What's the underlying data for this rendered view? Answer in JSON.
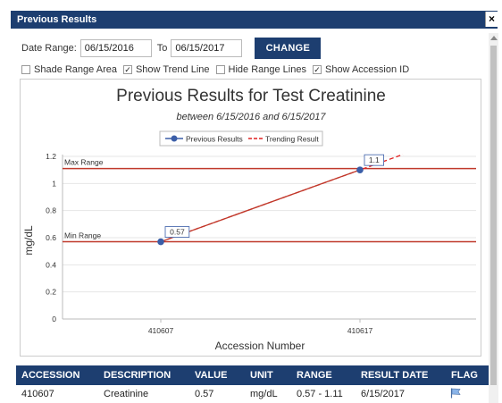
{
  "window": {
    "title": "Previous Results",
    "close": "×"
  },
  "toolbar": {
    "date_range_label": "Date Range:",
    "from_value": "06/15/2016",
    "to_label": "To",
    "to_value": "06/15/2017",
    "change_label": "CHANGE"
  },
  "options": [
    {
      "label": "Shade Range Area",
      "checked": false
    },
    {
      "label": "Show Trend Line",
      "checked": true
    },
    {
      "label": "Hide Range Lines",
      "checked": false
    },
    {
      "label": "Show Accession ID",
      "checked": true
    }
  ],
  "chart_data": {
    "type": "line",
    "title": "Previous Results for Test Creatinine",
    "subtitle": "between 6/15/2016 and 6/15/2017",
    "xlabel": "Accession Number",
    "ylabel": "mg/dL",
    "categories": [
      "410607",
      "410617"
    ],
    "ylim": [
      0,
      1.2
    ],
    "yticks": [
      "0",
      "0.2",
      "0.4",
      "0.6",
      "0.8",
      "1",
      "1.2"
    ],
    "legend": {
      "placement": "top-center",
      "items": [
        "Previous Results",
        "Trending Result"
      ]
    },
    "series": [
      {
        "name": "Previous Results",
        "values": [
          0.57,
          1.1
        ],
        "point_labels": [
          "0.57",
          "1.1"
        ],
        "color": "#1d3e70",
        "line_color": "#c0392b"
      },
      {
        "name": "Trending Result",
        "values": [
          0.57,
          1.1
        ],
        "extends_beyond": true,
        "color": "#e02020",
        "dashed": true
      }
    ],
    "reference_lines": [
      {
        "label": "Max Range",
        "value": 1.11,
        "color": "#c0392b"
      },
      {
        "label": "Min Range",
        "value": 0.57,
        "color": "#c0392b"
      }
    ]
  },
  "results": {
    "headers": [
      "ACCESSION",
      "DESCRIPTION",
      "VALUE",
      "UNIT",
      "RANGE",
      "RESULT DATE",
      "FLAG"
    ],
    "rows": [
      {
        "accession": "410607",
        "description": "Creatinine",
        "value": "0.57",
        "unit": "mg/dL",
        "range": "0.57 - 1.11",
        "date": "6/15/2017",
        "flag": "flag-icon"
      }
    ]
  },
  "colors": {
    "header_bg": "#1d3e70",
    "range_line": "#c0392b",
    "point": "#3b5ea8",
    "trend": "#e02020"
  }
}
